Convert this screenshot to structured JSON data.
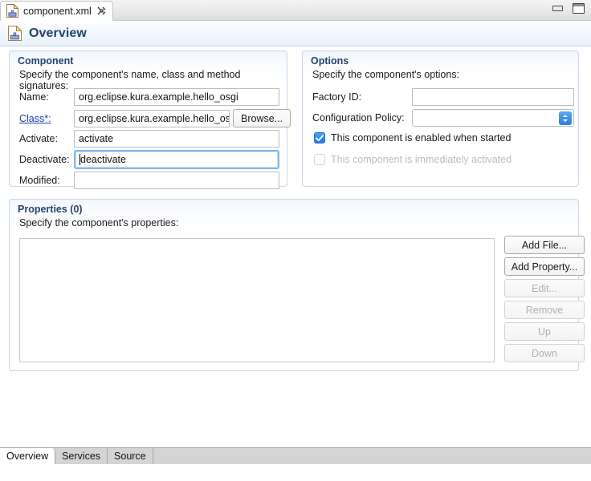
{
  "window": {
    "minimize_label": "Minimize",
    "maximize_label": "Maximize"
  },
  "editor_tab": {
    "label": "component.xml",
    "icon": "component-file-icon",
    "close_icon": "close-icon"
  },
  "form_header": {
    "title": "Overview",
    "icon": "component-file-icon"
  },
  "component_section": {
    "title": "Component",
    "description": "Specify the component's name, class and method signatures:",
    "fields": [
      {
        "label": "Name:",
        "value": "org.eclipse.kura.example.hello_osgi",
        "link": false,
        "focused": false
      },
      {
        "label": "Class*:",
        "value": "org.eclipse.kura.example.hello_osg",
        "link": true,
        "focused": false
      },
      {
        "label": "Activate:",
        "value": "activate",
        "link": false,
        "focused": false
      },
      {
        "label": "Deactivate:",
        "value": "deactivate",
        "link": false,
        "focused": true
      },
      {
        "label": "Modified:",
        "value": "",
        "link": false,
        "focused": false
      }
    ],
    "browse_button": "Browse..."
  },
  "options_section": {
    "title": "Options",
    "description": "Specify the component's options:",
    "factory_id_label": "Factory ID:",
    "factory_id_value": "",
    "config_policy_label": "Configuration Policy:",
    "config_policy_value": "",
    "checkbox_enabled": {
      "label": "This component is enabled when started",
      "checked": true,
      "disabled": false
    },
    "checkbox_immediate": {
      "label": "This component is immediately activated",
      "checked": false,
      "disabled": true
    }
  },
  "properties_section": {
    "title": "Properties (0)",
    "description": "Specify the component's properties:",
    "items": [],
    "buttons": [
      {
        "label": "Add File...",
        "disabled": false
      },
      {
        "label": "Add Property...",
        "disabled": false
      },
      {
        "label": "Edit...",
        "disabled": true
      },
      {
        "label": "Remove",
        "disabled": true
      },
      {
        "label": "Up",
        "disabled": true
      },
      {
        "label": "Down",
        "disabled": true
      }
    ]
  },
  "bottom_tabs": [
    {
      "label": "Overview",
      "active": true
    },
    {
      "label": "Services",
      "active": false
    },
    {
      "label": "Source",
      "active": false
    }
  ],
  "colors": {
    "section_border": "#c5d8ec",
    "section_title": "#25436b",
    "link": "#1a3fb0",
    "accent_blue": "#2a7fe0",
    "focus_ring": "#7eb6e8",
    "tabbar_gray": "#d4d4d4"
  }
}
